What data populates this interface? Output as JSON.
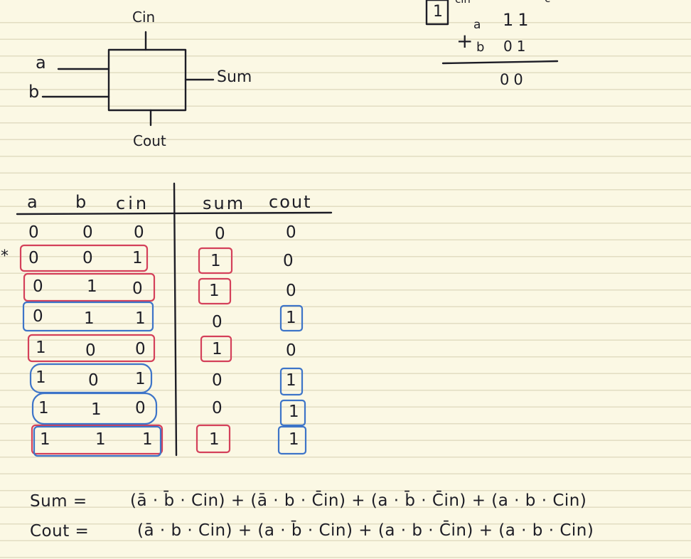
{
  "diagram": {
    "inputs": [
      "a",
      "b"
    ],
    "carry_in_label": "Cin",
    "output_label": "Sum",
    "carry_out_label": "Cout"
  },
  "addition": {
    "carry_box": "1",
    "carry_label": "cin",
    "carry_label2": "c",
    "row1_label": "a",
    "row1_value": "11",
    "operator": "+",
    "row2_label": "b",
    "row2_value": "01",
    "result": "00"
  },
  "truth_table": {
    "marker": "*",
    "headers": [
      "a",
      "b",
      "cin",
      "sum",
      "cout"
    ],
    "rows": [
      [
        "0",
        "0",
        "0",
        "0",
        "0"
      ],
      [
        "0",
        "0",
        "1",
        "1",
        "0"
      ],
      [
        "0",
        "1",
        "0",
        "1",
        "0"
      ],
      [
        "0",
        "1",
        "1",
        "0",
        "1"
      ],
      [
        "1",
        "0",
        "0",
        "1",
        "0"
      ],
      [
        "1",
        "0",
        "1",
        "0",
        "1"
      ],
      [
        "1",
        "1",
        "0",
        "0",
        "1"
      ],
      [
        "1",
        "1",
        "1",
        "1",
        "1"
      ]
    ],
    "sum_highlight_color": "#d4405a",
    "cout_highlight_color": "#3d74c8"
  },
  "equations": {
    "sum_lhs": "Sum =",
    "sum_rhs": "(ā · b̄ · Cin) + (ā · b · C̄in) + (a · b̄ · C̄in) + (a · b · Cin)",
    "cout_lhs": "Cout =",
    "cout_rhs": "(ā · b · Cin) + (a · b̄ · Cin) + (a · b · C̄in) + (a · b · Cin)"
  }
}
